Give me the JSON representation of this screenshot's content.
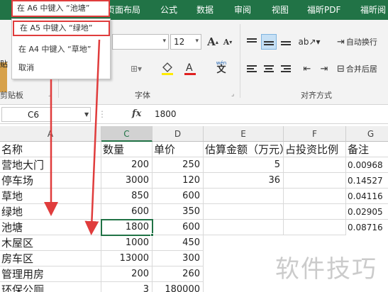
{
  "ribbon_tabs": [
    "页面布局",
    "公式",
    "数据",
    "审阅",
    "视图",
    "福昕PDF",
    "福昕阅"
  ],
  "menu": {
    "top_item": "在 A6 中键入 “池塘”",
    "items": [
      "在 A5 中键入 “绿地”",
      "在 A4 中键入 “草地”",
      "取消"
    ]
  },
  "ribbon": {
    "clipboard_label": "剪贴板",
    "paste_label": "贴",
    "font_label": "字体",
    "align_label": "对齐方式",
    "font_size": "12",
    "grow_font": "A",
    "shrink_font": "A",
    "wen": "wén",
    "wen_char": "文",
    "wrap_text": "自动换行",
    "merge_center": "合并后居"
  },
  "formula_bar": {
    "cell_ref": "C6",
    "fx": "fx",
    "value": "1800"
  },
  "columns": [
    "A",
    "C",
    "D",
    "E",
    "F",
    "G"
  ],
  "rows": [
    [
      "名称",
      "数量",
      "单价",
      "估算金额（万元）",
      "占投资比例",
      "备注"
    ],
    [
      "营地大门",
      "200",
      "250",
      "5",
      "",
      "0.00968"
    ],
    [
      "停车场",
      "3000",
      "120",
      "36",
      "",
      "0.14527"
    ],
    [
      "草地",
      "850",
      "600",
      "",
      "",
      "0.04116"
    ],
    [
      "绿地",
      "600",
      "350",
      "",
      "",
      "0.02905"
    ],
    [
      "池塘",
      "1800",
      "600",
      "",
      "",
      "0.08716"
    ],
    [
      "木屋区",
      "1000",
      "450",
      "",
      "",
      ""
    ],
    [
      "房车区",
      "13000",
      "300",
      "",
      "",
      ""
    ],
    [
      "管理用房",
      "200",
      "260",
      "",
      "",
      ""
    ],
    [
      "环保公厕",
      "3",
      "180000",
      "",
      "",
      ""
    ]
  ],
  "watermark": "软件技巧",
  "colors": {
    "ribbon_green": "#217346",
    "highlight_red": "#e03c3c",
    "selection_green": "#217346"
  }
}
